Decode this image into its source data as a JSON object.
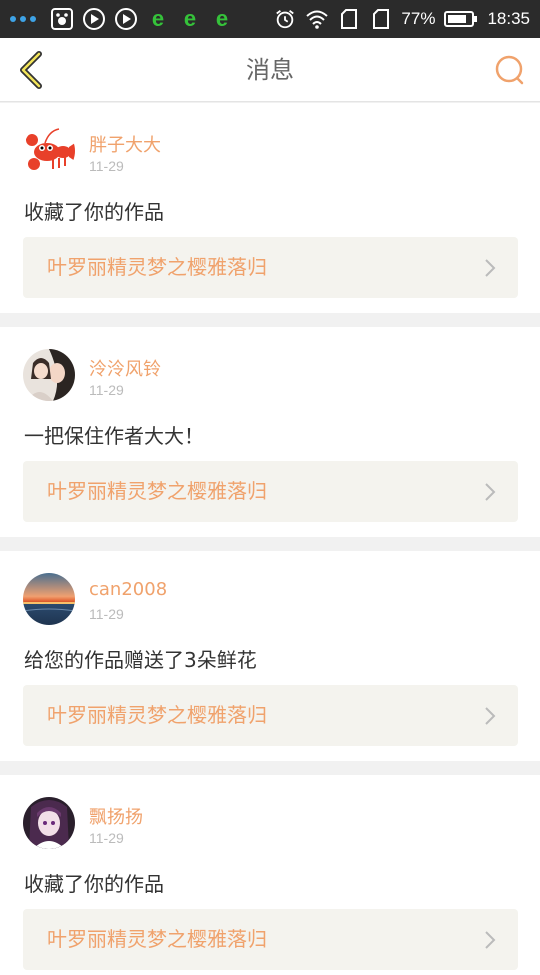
{
  "status_bar": {
    "battery": "77%",
    "time": "18:35"
  },
  "header": {
    "title": "消息"
  },
  "colors": {
    "accent": "#f0a26c",
    "background": "#f1f1f1",
    "link_bg": "#f4f3ee",
    "status_bar": "#2b2b2b"
  },
  "messages": [
    {
      "user": "胖子大大",
      "date": "11-29",
      "body": "收藏了你的作品",
      "work": "叶罗丽精灵梦之樱雅落归",
      "avatar": "lobster-avatar"
    },
    {
      "user": "泠泠风铃",
      "date": "11-29",
      "body": "一把保住作者大大！",
      "work": "叶罗丽精灵梦之樱雅落归",
      "avatar": "girl-photo-avatar"
    },
    {
      "user": "can2008",
      "date": "11-29",
      "body": "给您的作品赠送了3朵鲜花",
      "work": "叶罗丽精灵梦之樱雅落归",
      "avatar": "sunset-avatar"
    },
    {
      "user": "飘扬扬",
      "date": "11-29",
      "body": "收藏了你的作品",
      "work": "叶罗丽精灵梦之樱雅落归",
      "avatar": "anime-girl-avatar"
    }
  ]
}
